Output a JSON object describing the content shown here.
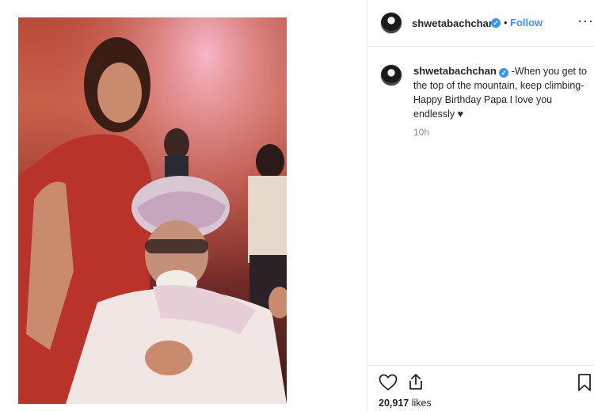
{
  "post": {
    "username": "shwetabachchan",
    "verified": true,
    "dot": "•",
    "follow_label": "Follow",
    "more_label": "···",
    "verified_glyph": "✓"
  },
  "caption": {
    "username": "shwetabachchan",
    "text": "-When you get to the top of the mountain, keep climbing- Happy Birthday Papa I love you endlessly ♥",
    "timestamp": "10h"
  },
  "actions": {
    "likes_count": "20,917",
    "likes_label": "likes"
  },
  "icons": {
    "heart": "heart-icon",
    "share": "share-icon",
    "bookmark": "bookmark-icon",
    "more": "more-icon",
    "verified": "verified-icon"
  },
  "colors": {
    "accent": "#3897f0",
    "text": "#262626",
    "muted": "#8e8e8e",
    "border": "#efefef"
  }
}
